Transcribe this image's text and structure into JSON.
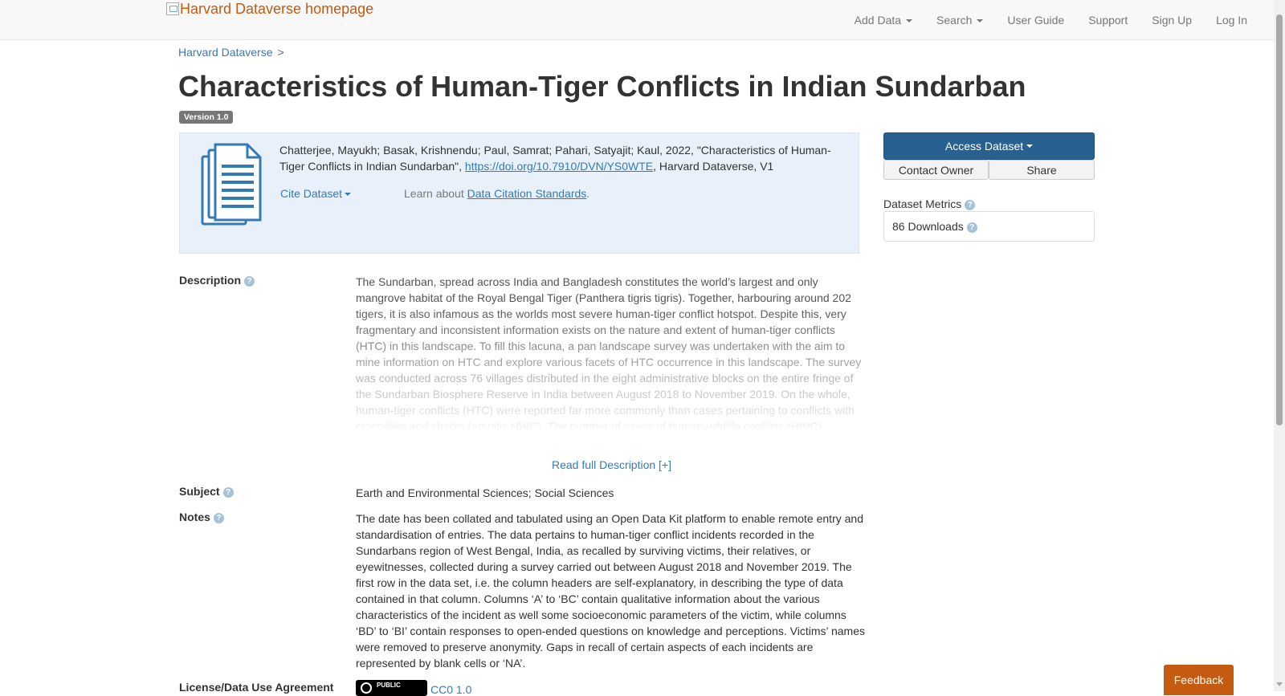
{
  "navbar": {
    "brand_text": "Harvard Dataverse homepage",
    "items": [
      {
        "label": "Add Data",
        "dropdown": true
      },
      {
        "label": "Search",
        "dropdown": true
      },
      {
        "label": "User Guide",
        "dropdown": false
      },
      {
        "label": "Support",
        "dropdown": false
      },
      {
        "label": "Sign Up",
        "dropdown": false
      },
      {
        "label": "Log In",
        "dropdown": false
      }
    ]
  },
  "breadcrumb": {
    "root": "Harvard Dataverse",
    "separator": ">"
  },
  "dataset": {
    "title": "Characteristics of Human-Tiger Conflicts in Indian Sundarban",
    "version": "Version 1.0"
  },
  "citation": {
    "text_before": "Chatterjee, Mayukh; Basak, Krishnendu; Paul, Samrat; Pahari, Satyajit; Kaul, 2022, \"Characteristics of Human-Tiger Conflicts in Indian Sundarban\", ",
    "doi": "https://doi.org/10.7910/DVN/YS0WTE",
    "text_after": ", Harvard Dataverse, V1",
    "cite_label": "Cite Dataset",
    "learn_prefix": "Learn about ",
    "learn_link": "Data Citation Standards",
    "learn_suffix": "."
  },
  "actions": {
    "access_label": "Access Dataset",
    "contact_label": "Contact Owner",
    "share_label": "Share"
  },
  "metrics": {
    "label": "Dataset Metrics",
    "downloads": "86 Downloads"
  },
  "metadata": {
    "description_label": "Description",
    "description": "The Sundarban, spread across India and Bangladesh constitutes the world’s largest and only mangrove habitat of the Royal Bengal Tiger (Panthera tigris tigris). Together, harbouring around 202 tigers, it is also infamous as the worlds most severe human-tiger conflict hotspot. Despite this, very fragmentary and inconsistent information exists on the nature and extent of human-tiger conflicts (HTC) in this landscape. To fill this lacuna, a pan landscape survey was undertaken with the aim to mine information on HTC and explore various facets of HTC occurrence in this landscape. The survey was conducted across 76 villages distributed in the eight administrative blocks on the entire fringe of the Sundarban Biosphere Reserve in India between August 2018 to November 2019. On the whole, human-tiger conflicts (HTC) were reported far more commonly than cases pertaining to conflicts with crocodiles and sharks (aquatic HWC). The number of cases of human-wildlife conflicts (HWC)",
    "read_more": "Read full Description [+]",
    "subject_label": "Subject",
    "subject": "Earth and Environmental Sciences; Social Sciences",
    "notes_label": "Notes",
    "notes": "The date has been collated and tabulated using an Open Data Kit platform to enable remote entry and standardisation of entries. The data pertains to human-tiger conflict incidents recorded in the Sundarbans region of West Bengal, India, as recalled by surviving victims, their relatives, or eyewitnesses, collected during a survey carried out between August 2018 and November 2019. The first row in the data set, i.e. the column headers are self-explanatory, in describing the type of data contained in that column. Columns ‘A’ to ‘BC’ contain qualitative information about the various characteristics of the incident as well some socioeconomic parameters of the victim, while columns ‘BD’ to ‘BI’ contain responses to open-ended questions on knowledge and perceptions. Victims’ names were removed to preserve anonymity. Gaps in recall of certain aspects of each incidents are represented by blank cells or ‘NA’.",
    "license_label": "License/Data Use Agreement",
    "license_badge": "PUBLIC",
    "license_link": "CC0 1.0"
  },
  "feedback_label": "Feedback",
  "colors": {
    "brand": "#c55a11",
    "primary": "#286090",
    "link": "#337ab7",
    "citation_bg": "#e8f1f9"
  }
}
